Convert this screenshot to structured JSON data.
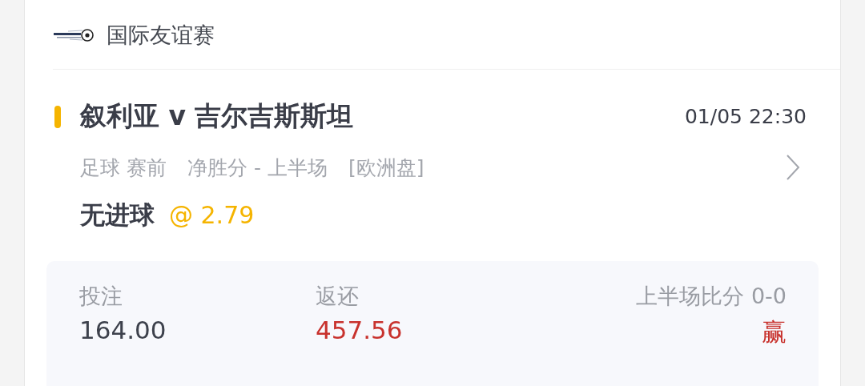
{
  "league": {
    "name": "国际友谊赛"
  },
  "match": {
    "title": "叙利亚 v 吉尔吉斯斯坦",
    "time": "01/05 22:30",
    "meta": [
      "足球 赛前",
      "净胜分 - 上半场",
      "[欧洲盘]"
    ],
    "selection": "无进球",
    "odds": "@ 2.79"
  },
  "summary": {
    "stake_label": "投注",
    "stake": "164.00",
    "return_label": "返还",
    "return": "457.56",
    "score_label": "上半场比分",
    "score": "0-0",
    "result": "赢",
    "won": true
  }
}
